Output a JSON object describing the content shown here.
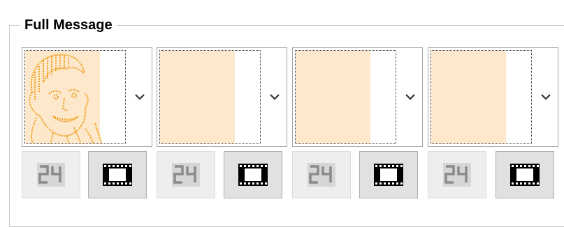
{
  "group": {
    "title": "Full Message"
  },
  "slots": [
    {
      "index": 1,
      "has_image": true,
      "image_icon": "caricature-face-icon",
      "counter_icon": "digit-24-icon",
      "animation_icon": "film-strip-icon"
    },
    {
      "index": 2,
      "has_image": false,
      "counter_icon": "digit-24-icon",
      "animation_icon": "film-strip-icon"
    },
    {
      "index": 3,
      "has_image": false,
      "counter_icon": "digit-24-icon",
      "animation_icon": "film-strip-icon"
    },
    {
      "index": 4,
      "has_image": false,
      "counter_icon": "digit-24-icon",
      "animation_icon": "film-strip-icon"
    }
  ],
  "colors": {
    "preview_fill": "#fde8cc",
    "drawing": "#f0a020",
    "counter_digits": "#888888"
  }
}
